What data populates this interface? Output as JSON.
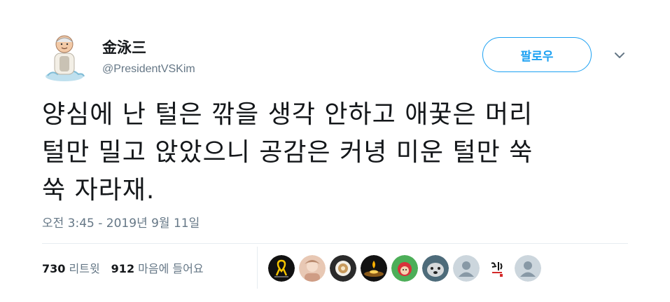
{
  "author": {
    "name": "金泳三",
    "handle": "@PresidentVSKim"
  },
  "follow_label": "팔로우",
  "tweet": {
    "lines": [
      "양심에 난 털은 깎을 생각 안하고 애꿎은 머리",
      "털만 밀고 앉았으니 공감은 커녕 미운 털만 쑥",
      "쑥 자라재."
    ],
    "timestamp": "오전 3:45 - 2019년 9월 11일"
  },
  "stats": {
    "retweets_count": "730",
    "retweets_label": "리트윗",
    "likes_count": "912",
    "likes_label": "마음에 들어요"
  },
  "liker_avatars": [
    "black-yellow-ribbon-avatar",
    "portrait-photo-avatar",
    "coffee-cup-avatar",
    "candle-light-avatar",
    "cartoon-character-avatar",
    "dog-photo-avatar",
    "default-user-avatar",
    "calligraphy-avatar",
    "default-user-avatar"
  ],
  "colors": {
    "accent": "#1da1f2",
    "text": "#14171a",
    "secondary": "#657786",
    "divider": "#e6ecf0"
  }
}
